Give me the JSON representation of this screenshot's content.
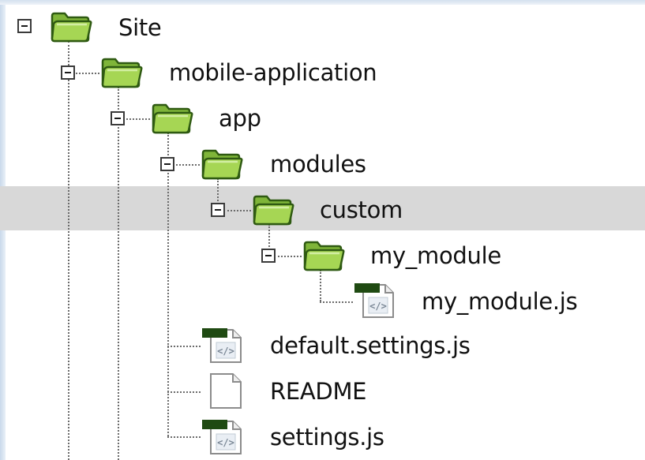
{
  "tree": {
    "nodes": [
      {
        "id": "site",
        "label": "Site",
        "type": "folder",
        "expanded": true,
        "selected": false
      },
      {
        "id": "mobile-application",
        "label": "mobile-application",
        "type": "folder",
        "expanded": true,
        "selected": false
      },
      {
        "id": "app",
        "label": "app",
        "type": "folder",
        "expanded": true,
        "selected": false
      },
      {
        "id": "modules",
        "label": "modules",
        "type": "folder",
        "expanded": true,
        "selected": false
      },
      {
        "id": "custom",
        "label": "custom",
        "type": "folder",
        "expanded": true,
        "selected": true
      },
      {
        "id": "my-module",
        "label": "my_module",
        "type": "folder",
        "expanded": true,
        "selected": false
      },
      {
        "id": "my-module-js",
        "label": "my_module.js",
        "type": "script-file",
        "selected": false
      },
      {
        "id": "default-settings-js",
        "label": "default.settings.js",
        "type": "script-file",
        "selected": false
      },
      {
        "id": "readme",
        "label": "README",
        "type": "text-file",
        "selected": false
      },
      {
        "id": "settings-js",
        "label": "settings.js",
        "type": "script-file",
        "selected": false
      }
    ]
  },
  "icons": {
    "folder": "folder-open-icon",
    "script_file": "script-file-icon",
    "text_file": "text-file-icon",
    "toggle": "collapse-icon"
  },
  "colors": {
    "selection": "#d8d8d8",
    "folder_fill": "#9dd04a",
    "folder_outline": "#2f5a12",
    "file_accent": "#1f4a12"
  }
}
